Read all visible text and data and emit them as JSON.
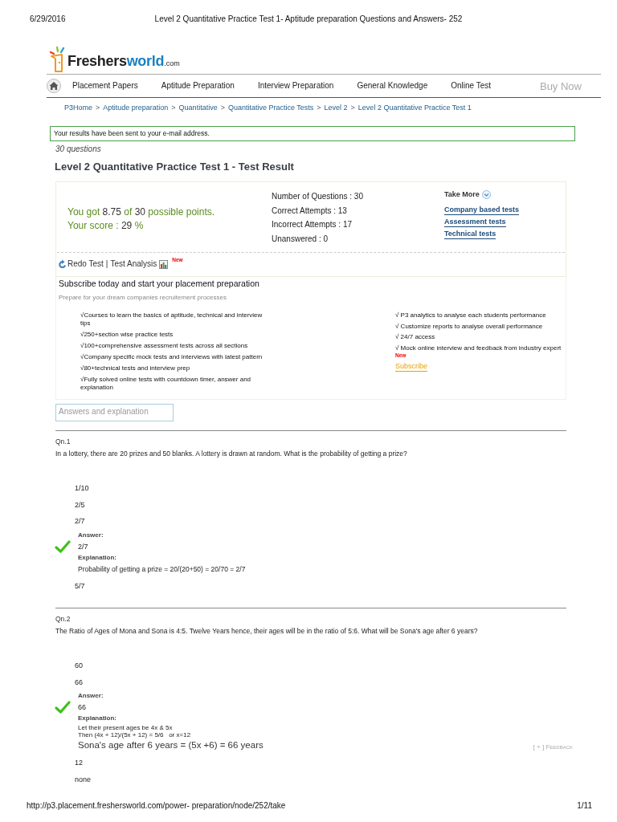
{
  "print_header": {
    "date": "6/29/2016",
    "title": "Level 2 Quantitative Practice Test 1- Aptitude preparation Questions and Answers- 252"
  },
  "logo": {
    "text": "Freshers",
    "accent": "world",
    "domain": ".com"
  },
  "nav": {
    "items": [
      {
        "label": "Placement Papers"
      },
      {
        "label": "Aptitude Preparation"
      },
      {
        "label": "Interview Preparation"
      },
      {
        "label": "General Knowledge"
      },
      {
        "label": "Online Test"
      }
    ],
    "buy_now": "Buy Now"
  },
  "breadcrumb": [
    {
      "label": "P3Home",
      "separator": ">"
    },
    {
      "label": "Aptitude preparation",
      "separator": ">"
    },
    {
      "label": "Quantitative",
      "separator": ">"
    },
    {
      "label": "Quantitative Practice Tests",
      "separator": ">"
    },
    {
      "label": "Level 2",
      "separator": ">"
    },
    {
      "label": "Level 2 Quantitative Practice Test 1"
    }
  ],
  "notice": "Your results have been sent to your e-mail address.",
  "question_count": "30 questions",
  "result_title": "Level 2 Quantitative Practice Test 1 - Test Result",
  "score": {
    "points": {
      "prefix": "You got",
      "earned": "8.75",
      "middle": "of",
      "total": "30",
      "suffix": "possible points."
    },
    "percent": {
      "label": "Your score :",
      "value": "29",
      "unit": "%"
    }
  },
  "stats": [
    "Number of Questions : 30",
    "Correct Attempts : 13",
    "Incorrect Attempts : 17",
    "Unanswered : 0"
  ],
  "take_more": {
    "label": "Take More",
    "links": [
      "Company based tests",
      "Assessment tests",
      "Technical tests"
    ]
  },
  "actions": {
    "redo": "Redo Test",
    "separator": "|",
    "analysis": "Test Analysis",
    "badge": "New"
  },
  "subscribe": {
    "title": "Subscribe today and start your placement preparation",
    "subtitle": "Prepare for your dream companies recruitement processes",
    "features_left": [
      "√Courses to learn the basics of aptitude, technical and interview tips",
      "√250+section wise practice tests",
      "√100+comprehensive assessment tests across all sections",
      "√Company specific mock tests and interviews with latest pattern",
      "√80+technical tests and interview prep",
      "√Fully solved online tests with countdown timer, answer and explanation"
    ],
    "features_right": [
      {
        "text": "√ P3 analytics to analyse each students performance"
      },
      {
        "text": "√ Customize reports to analyse overall performance"
      },
      {
        "text": "√ 24/7 access"
      },
      {
        "text": "√ Mock online interview and feedback from industry expert",
        "badge": "New"
      }
    ],
    "link": "Subscribe"
  },
  "answers_tab": "Answers and explanation",
  "questions": [
    {
      "number": "Qn.1",
      "text": "In a lottery, there are 20 prizes and 50 blanks. A lottery is drawn at random. What is the probability of getting a prize?",
      "options": [
        {
          "text": "1/10",
          "correct": false
        },
        {
          "text": "2/5",
          "correct": false
        },
        {
          "text": "2/7",
          "correct": true
        },
        {
          "text": "5/7",
          "correct": false
        }
      ],
      "answer": {
        "label": "Answer:",
        "value": "2/7",
        "explanation_label": "Explanation:",
        "explanation": [
          {
            "text": "Probability of getting a prize = 20/(20+50) = 20/70 = 2/7",
            "kind": "normal"
          }
        ]
      }
    },
    {
      "number": "Qn.2",
      "text": "The Ratio of Ages of Mona and Sona is 4:5. Twelve Years hence, their ages will be in the ratio of 5:6. What will be Sona's age after 6 years?",
      "options": [
        {
          "text": "60",
          "correct": false
        },
        {
          "text": "66",
          "correct": true
        },
        {
          "text": "12",
          "correct": false
        },
        {
          "text": "none",
          "correct": false
        }
      ],
      "answer": {
        "label": "Answer:",
        "value": "66",
        "explanation_label": "Explanation:",
        "explanation": [
          {
            "text": "Let their present ages be 4x & 5x",
            "kind": "small"
          },
          {
            "text": "Then (4x + 12)/(5x + 12) = 5/6   or x=12",
            "kind": "small"
          },
          {
            "text": "Sona's age after 6 years = (5x +6) = 66 years",
            "kind": "large"
          }
        ]
      },
      "feedback": "[ + ] Feedback"
    }
  ],
  "print_footer": {
    "url": "http://p3.placement.freshersworld.com/power- preparation/node/252/take",
    "page": "1/11"
  }
}
